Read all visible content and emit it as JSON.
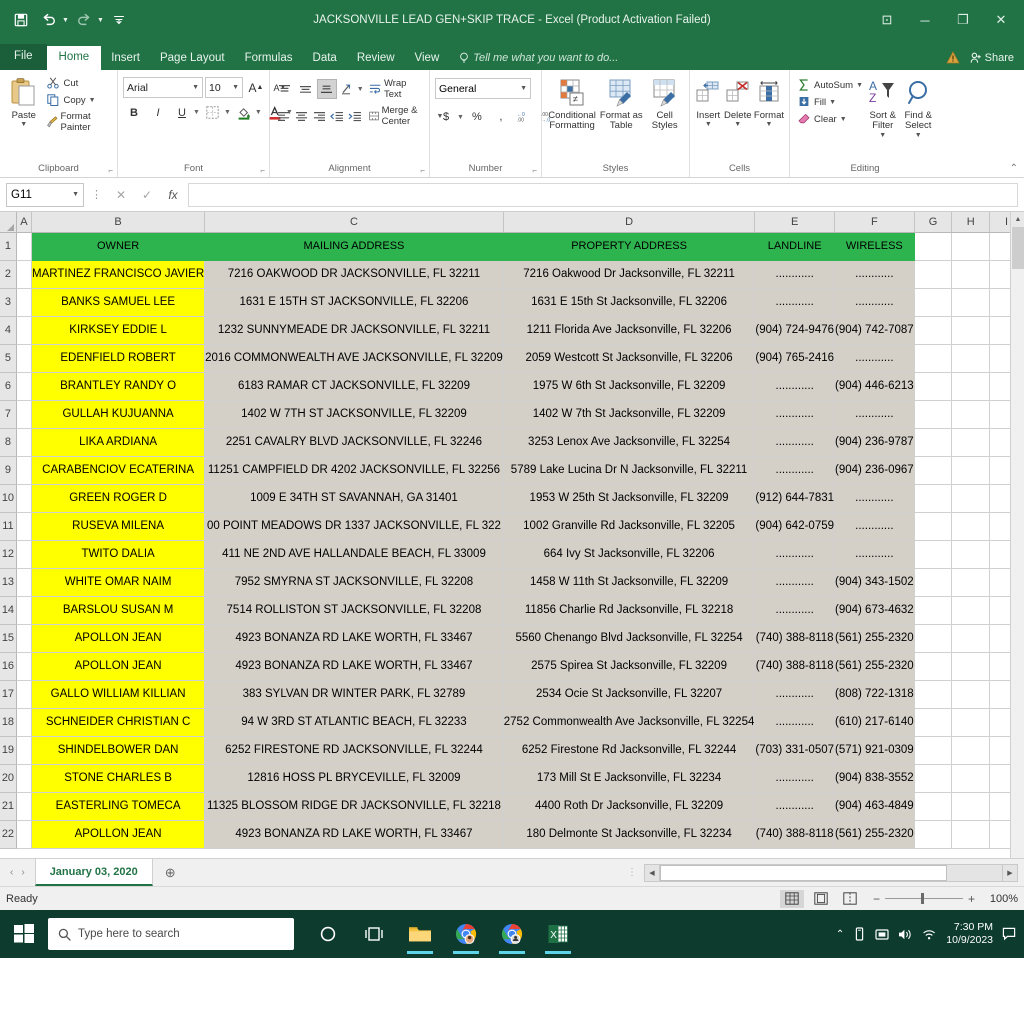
{
  "titlebar": {
    "title": "JACKSONVILLE LEAD GEN+SKIP TRACE - Excel (Product Activation Failed)",
    "qat": [
      {
        "name": "save-button",
        "icon": "save-icon"
      },
      {
        "name": "undo-button",
        "icon": "undo-icon"
      },
      {
        "name": "redo-button",
        "icon": "redo-icon"
      },
      {
        "name": "customize-qat-button",
        "icon": "chevron-down-icon"
      }
    ],
    "window_controls": {
      "ribbon_display": "⊡",
      "minimize": "─",
      "restore": "❐",
      "close": "✕"
    }
  },
  "ribbon_tabs": {
    "file": "File",
    "items": [
      "Home",
      "Insert",
      "Page Layout",
      "Formulas",
      "Data",
      "Review",
      "View"
    ],
    "active": "Home",
    "tell_me": "Tell me what you want to do...",
    "share": "Share"
  },
  "ribbon": {
    "clipboard": {
      "label": "Clipboard",
      "paste": "Paste",
      "cut": "Cut",
      "copy": "Copy",
      "format_painter": "Format Painter"
    },
    "font": {
      "label": "Font",
      "family": "Arial",
      "size": "10",
      "grow": "A",
      "shrink": "A",
      "bold": "B",
      "italic": "I",
      "underline": "U"
    },
    "alignment": {
      "label": "Alignment",
      "wrap_text": "Wrap Text",
      "merge_center": "Merge & Center"
    },
    "number": {
      "label": "Number",
      "format": "General",
      "currency": "$",
      "percent": "%",
      "comma": ","
    },
    "styles": {
      "label": "Styles",
      "conditional_formatting": "Conditional Formatting",
      "format_as_table": "Format as Table",
      "cell_styles": "Cell Styles"
    },
    "cells": {
      "label": "Cells",
      "insert": "Insert",
      "delete": "Delete",
      "format": "Format"
    },
    "editing": {
      "label": "Editing",
      "autosum": "AutoSum",
      "fill": "Fill",
      "clear": "Clear",
      "sort_filter": "Sort & Filter",
      "find_select": "Find & Select"
    }
  },
  "formula_bar": {
    "name_box": "G11",
    "cancel": "✕",
    "enter": "✓",
    "fx": "fx",
    "value": ""
  },
  "grid": {
    "column_letters": [
      "A",
      "B",
      "C",
      "D",
      "E",
      "F",
      "G",
      "H",
      "I"
    ],
    "headers": {
      "B": "OWNER",
      "C": "MAILING ADDRESS",
      "D": "PROPERTY ADDRESS",
      "E": "LANDLINE",
      "F": "WIRELESS"
    },
    "blank": "",
    "dots": "............",
    "rows": [
      {
        "n": "2",
        "owner": "MARTINEZ FRANCISCO JAVIER",
        "mailing": "7216 OAKWOOD DR JACKSONVILLE, FL 32211",
        "property": "7216 Oakwood Dr Jacksonville, FL 32211",
        "landline": "............",
        "wireless": "............"
      },
      {
        "n": "3",
        "owner": "BANKS SAMUEL LEE",
        "mailing": "1631 E 15TH ST JACKSONVILLE, FL 32206",
        "property": "1631 E 15th St Jacksonville, FL 32206",
        "landline": "............",
        "wireless": "............"
      },
      {
        "n": "4",
        "owner": "KIRKSEY EDDIE L",
        "mailing": "1232 SUNNYMEADE DR JACKSONVILLE, FL 32211",
        "property": "1211 Florida Ave Jacksonville, FL 32206",
        "landline": "(904) 724-9476",
        "wireless": "(904) 742-7087"
      },
      {
        "n": "5",
        "owner": "EDENFIELD ROBERT",
        "mailing": "2016 COMMONWEALTH AVE JACKSONVILLE, FL 32209",
        "property": "2059 Westcott St Jacksonville, FL 32206",
        "landline": "(904) 765-2416",
        "wireless": "............"
      },
      {
        "n": "6",
        "owner": "BRANTLEY RANDY O",
        "mailing": "6183 RAMAR CT JACKSONVILLE, FL 32209",
        "property": "1975 W 6th St Jacksonville, FL 32209",
        "landline": "............",
        "wireless": "(904) 446-6213"
      },
      {
        "n": "7",
        "owner": "GULLAH KUJUANNA",
        "mailing": "1402 W 7TH ST JACKSONVILLE, FL 32209",
        "property": "1402 W 7th St Jacksonville, FL 32209",
        "landline": "............",
        "wireless": "............"
      },
      {
        "n": "8",
        "owner": "LIKA ARDIANA",
        "mailing": "2251 CAVALRY BLVD JACKSONVILLE, FL 32246",
        "property": "3253 Lenox Ave Jacksonville, FL 32254",
        "landline": "............",
        "wireless": "(904) 236-9787"
      },
      {
        "n": "9",
        "owner": "CARABENCIOV ECATERINA",
        "mailing": "11251 CAMPFIELD DR 4202 JACKSONVILLE, FL 32256",
        "property": "5789 Lake Lucina Dr N Jacksonville, FL 32211",
        "landline": "............",
        "wireless": "(904) 236-0967"
      },
      {
        "n": "10",
        "owner": "GREEN ROGER D",
        "mailing": "1009 E 34TH ST SAVANNAH, GA 31401",
        "property": "1953 W 25th St Jacksonville, FL 32209",
        "landline": "(912) 644-7831",
        "wireless": "............"
      },
      {
        "n": "11",
        "owner": "RUSEVA MILENA",
        "mailing": "00 POINT MEADOWS DR 1337 JACKSONVILLE, FL 322",
        "property": "1002 Granville Rd Jacksonville, FL 32205",
        "landline": "(904) 642-0759",
        "wireless": "............"
      },
      {
        "n": "12",
        "owner": "TWITO DALIA",
        "mailing": "411 NE 2ND AVE HALLANDALE BEACH, FL 33009",
        "property": "664 Ivy St Jacksonville, FL 32206",
        "landline": "............",
        "wireless": "............"
      },
      {
        "n": "13",
        "owner": "WHITE OMAR NAIM",
        "mailing": "7952 SMYRNA ST JACKSONVILLE, FL 32208",
        "property": "1458 W 11th St Jacksonville, FL 32209",
        "landline": "............",
        "wireless": "(904) 343-1502"
      },
      {
        "n": "14",
        "owner": "BARSLOU SUSAN M",
        "mailing": "7514 ROLLISTON ST JACKSONVILLE, FL 32208",
        "property": "11856 Charlie Rd Jacksonville, FL 32218",
        "landline": "............",
        "wireless": "(904) 673-4632"
      },
      {
        "n": "15",
        "owner": "APOLLON JEAN",
        "mailing": "4923 BONANZA RD LAKE WORTH, FL 33467",
        "property": "5560 Chenango Blvd Jacksonville, FL 32254",
        "landline": "(740) 388-8118",
        "wireless": "(561) 255-2320"
      },
      {
        "n": "16",
        "owner": "APOLLON JEAN",
        "mailing": "4923 BONANZA RD LAKE WORTH, FL 33467",
        "property": "2575 Spirea St Jacksonville, FL 32209",
        "landline": "(740) 388-8118",
        "wireless": "(561) 255-2320"
      },
      {
        "n": "17",
        "owner": "GALLO WILLIAM KILLIAN",
        "mailing": "383 SYLVAN DR WINTER PARK, FL 32789",
        "property": "2534 Ocie St Jacksonville, FL 32207",
        "landline": "............",
        "wireless": "(808) 722-1318"
      },
      {
        "n": "18",
        "owner": "SCHNEIDER CHRISTIAN C",
        "mailing": "94 W 3RD ST ATLANTIC BEACH, FL 32233",
        "property": "2752 Commonwealth Ave Jacksonville, FL 32254",
        "landline": "............",
        "wireless": "(610) 217-6140"
      },
      {
        "n": "19",
        "owner": "SHINDELBOWER DAN",
        "mailing": "6252 FIRESTONE RD JACKSONVILLE, FL 32244",
        "property": "6252 Firestone Rd Jacksonville, FL 32244",
        "landline": "(703) 331-0507",
        "wireless": "(571) 921-0309"
      },
      {
        "n": "20",
        "owner": "STONE CHARLES B",
        "mailing": "12816 HOSS PL BRYCEVILLE, FL 32009",
        "property": "173 Mill St E Jacksonville, FL 32234",
        "landline": "............",
        "wireless": "(904) 838-3552"
      },
      {
        "n": "21",
        "owner": "EASTERLING TOMECA",
        "mailing": "11325 BLOSSOM RIDGE DR JACKSONVILLE, FL 32218",
        "property": "4400 Roth Dr Jacksonville, FL 32209",
        "landline": "............",
        "wireless": "(904) 463-4849"
      },
      {
        "n": "22",
        "owner": "APOLLON JEAN",
        "mailing": "4923 BONANZA RD LAKE WORTH, FL 33467",
        "property": "180 Delmonte St Jacksonville, FL 32234",
        "landline": "(740) 388-8118",
        "wireless": "(561) 255-2320"
      }
    ]
  },
  "sheet_bar": {
    "prev": "‹",
    "next": "›",
    "tab_name": "January 03, 2020",
    "add_sheet": "⊕"
  },
  "status_bar": {
    "status": "Ready",
    "zoom": "100%",
    "views": [
      "normal-view",
      "page-layout-view",
      "page-break-view"
    ]
  },
  "taskbar": {
    "search_placeholder": "Type here to search",
    "icons": [
      "cortana-icon",
      "task-view-icon",
      "file-explorer-icon",
      "chrome-icon",
      "chrome-icon",
      "excel-icon"
    ],
    "tray": [
      "show-hidden-icons",
      "onedrive-icon",
      "display-icon",
      "volume-icon",
      "network-icon"
    ],
    "time": "7:30 PM",
    "date": "10/9/2023"
  },
  "colors": {
    "excel_green": "#217346",
    "header_green": "#2EB44F",
    "owner_yellow": "#FFFF00",
    "data_grey": "#D4D0C8",
    "taskbar": "#0d3b2e"
  }
}
